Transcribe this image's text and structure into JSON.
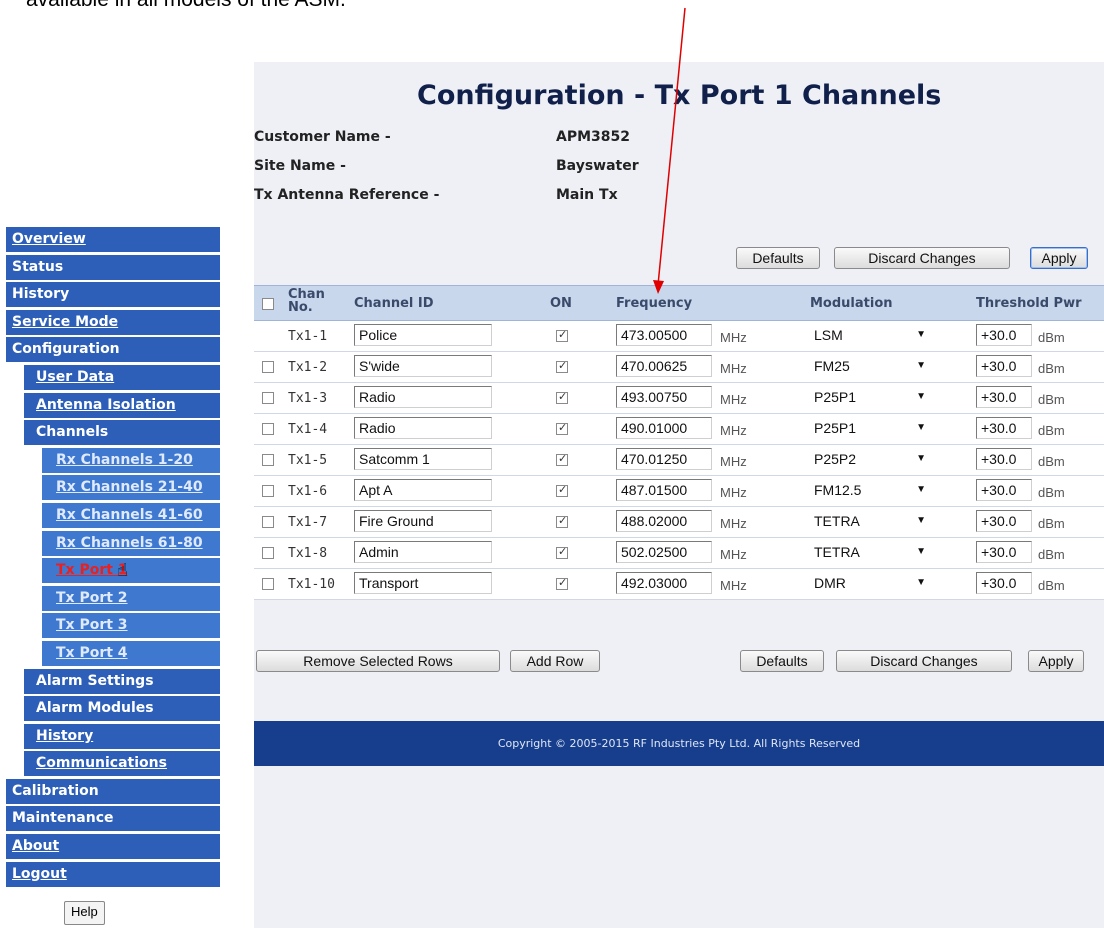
{
  "doc_caption": "available in all models of the ASM.",
  "page_title": "Configuration - Tx Port 1 Channels",
  "info": [
    {
      "label": "Customer Name -",
      "value": "APM3852"
    },
    {
      "label": "Site Name -",
      "value": "Bayswater"
    },
    {
      "label": "Tx Antenna Reference -",
      "value": "Main Tx"
    }
  ],
  "sidebar": {
    "items": [
      {
        "label": "Overview",
        "level": 0,
        "link": true
      },
      {
        "label": "Status",
        "level": 0,
        "link": false
      },
      {
        "label": "History",
        "level": 0,
        "link": false
      },
      {
        "label": "Service Mode",
        "level": 0,
        "link": true
      },
      {
        "label": "Configuration",
        "level": 0,
        "link": false
      },
      {
        "label": "User Data",
        "level": 1,
        "link": true
      },
      {
        "label": "Antenna Isolation",
        "level": 1,
        "link": true
      },
      {
        "label": "Channels",
        "level": 1,
        "link": false
      },
      {
        "label": "Rx Channels 1-20",
        "level": 2,
        "link": true
      },
      {
        "label": "Rx Channels 21-40",
        "level": 2,
        "link": true
      },
      {
        "label": "Rx Channels 41-60",
        "level": 2,
        "link": true
      },
      {
        "label": "Rx Channels 61-80",
        "level": 2,
        "link": true
      },
      {
        "label": "Tx Port 1",
        "level": 2,
        "link": true,
        "active": true
      },
      {
        "label": "Tx Port 2",
        "level": 2,
        "link": true
      },
      {
        "label": "Tx Port 3",
        "level": 2,
        "link": true
      },
      {
        "label": "Tx Port 4",
        "level": 2,
        "link": true
      },
      {
        "label": "Alarm Settings",
        "level": 1,
        "link": false
      },
      {
        "label": "Alarm Modules",
        "level": 1,
        "link": false
      },
      {
        "label": "History",
        "level": 1,
        "link": true
      },
      {
        "label": "Communications",
        "level": 1,
        "link": true
      },
      {
        "label": "Calibration",
        "level": 0,
        "link": false
      },
      {
        "label": "Maintenance",
        "level": 0,
        "link": false
      },
      {
        "label": "About",
        "level": 0,
        "link": true
      },
      {
        "label": "Logout",
        "level": 0,
        "link": true
      }
    ],
    "help_label": "Help"
  },
  "top_buttons": {
    "defaults": "Defaults",
    "discard": "Discard Changes",
    "apply": "Apply"
  },
  "bottom_buttons": {
    "remove": "Remove Selected Rows",
    "add": "Add Row",
    "defaults": "Defaults",
    "discard": "Discard Changes",
    "apply": "Apply"
  },
  "table": {
    "headers": {
      "chan": "Chan No.",
      "chan_l1": "Chan",
      "chan_l2": "No.",
      "channel_id": "Channel ID",
      "on": "ON",
      "frequency": "Frequency",
      "modulation": "Modulation",
      "threshold": "Threshold Pwr"
    },
    "freq_unit": "MHz",
    "pwr_unit": "dBm",
    "rows": [
      {
        "chan": "Tx1-1",
        "id": "Police",
        "on": true,
        "freq": "473.00500",
        "mod": "LSM",
        "pwr": "+30.0",
        "has_checkbox": false
      },
      {
        "chan": "Tx1-2",
        "id": "S'wide",
        "on": true,
        "freq": "470.00625",
        "mod": "FM25",
        "pwr": "+30.0",
        "has_checkbox": true
      },
      {
        "chan": "Tx1-3",
        "id": "Radio",
        "on": true,
        "freq": "493.00750",
        "mod": "P25P1",
        "pwr": "+30.0",
        "has_checkbox": true
      },
      {
        "chan": "Tx1-4",
        "id": "Radio",
        "on": true,
        "freq": "490.01000",
        "mod": "P25P1",
        "pwr": "+30.0",
        "has_checkbox": true
      },
      {
        "chan": "Tx1-5",
        "id": "Satcomm 1",
        "on": true,
        "freq": "470.01250",
        "mod": "P25P2",
        "pwr": "+30.0",
        "has_checkbox": true
      },
      {
        "chan": "Tx1-6",
        "id": "Apt A",
        "on": true,
        "freq": "487.01500",
        "mod": "FM12.5",
        "pwr": "+30.0",
        "has_checkbox": true
      },
      {
        "chan": "Tx1-7",
        "id": "Fire Ground",
        "on": true,
        "freq": "488.02000",
        "mod": "TETRA",
        "pwr": "+30.0",
        "has_checkbox": true
      },
      {
        "chan": "Tx1-8",
        "id": "Admin",
        "on": true,
        "freq": "502.02500",
        "mod": "TETRA",
        "pwr": "+30.0",
        "has_checkbox": true
      },
      {
        "chan": "Tx1-10",
        "id": "Transport",
        "on": true,
        "freq": "492.03000",
        "mod": "DMR",
        "pwr": "+30.0",
        "has_checkbox": true
      }
    ]
  },
  "footer": "Copyright © 2005-2015 RF Industries Pty Ltd. All Rights Reserved",
  "colors": {
    "nav": "#2e5fb8",
    "nav_sub": "#3f78cf",
    "footer": "#163e8c",
    "panel": "#eef0f6",
    "arrow": "#e00000",
    "active": "#e82020"
  }
}
